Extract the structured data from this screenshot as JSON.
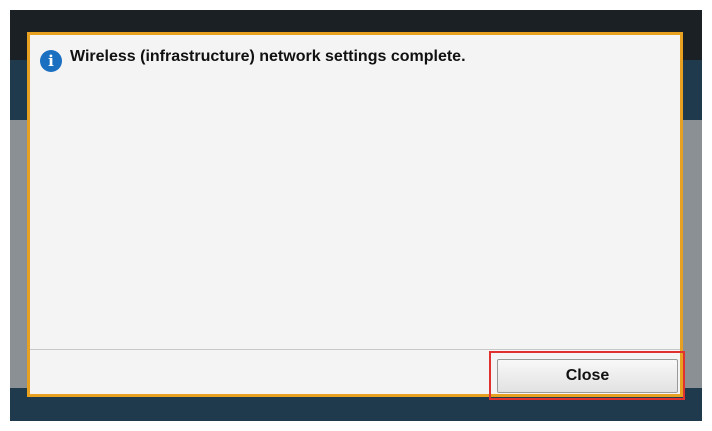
{
  "dialog": {
    "message": "Wireless (infrastructure) network settings complete.",
    "icon": "info-icon",
    "icon_glyph": "i",
    "close_label": "Close"
  },
  "colors": {
    "dialog_border": "#e8a020",
    "highlight": "#e03030",
    "icon_bg": "#1a6fc0"
  }
}
